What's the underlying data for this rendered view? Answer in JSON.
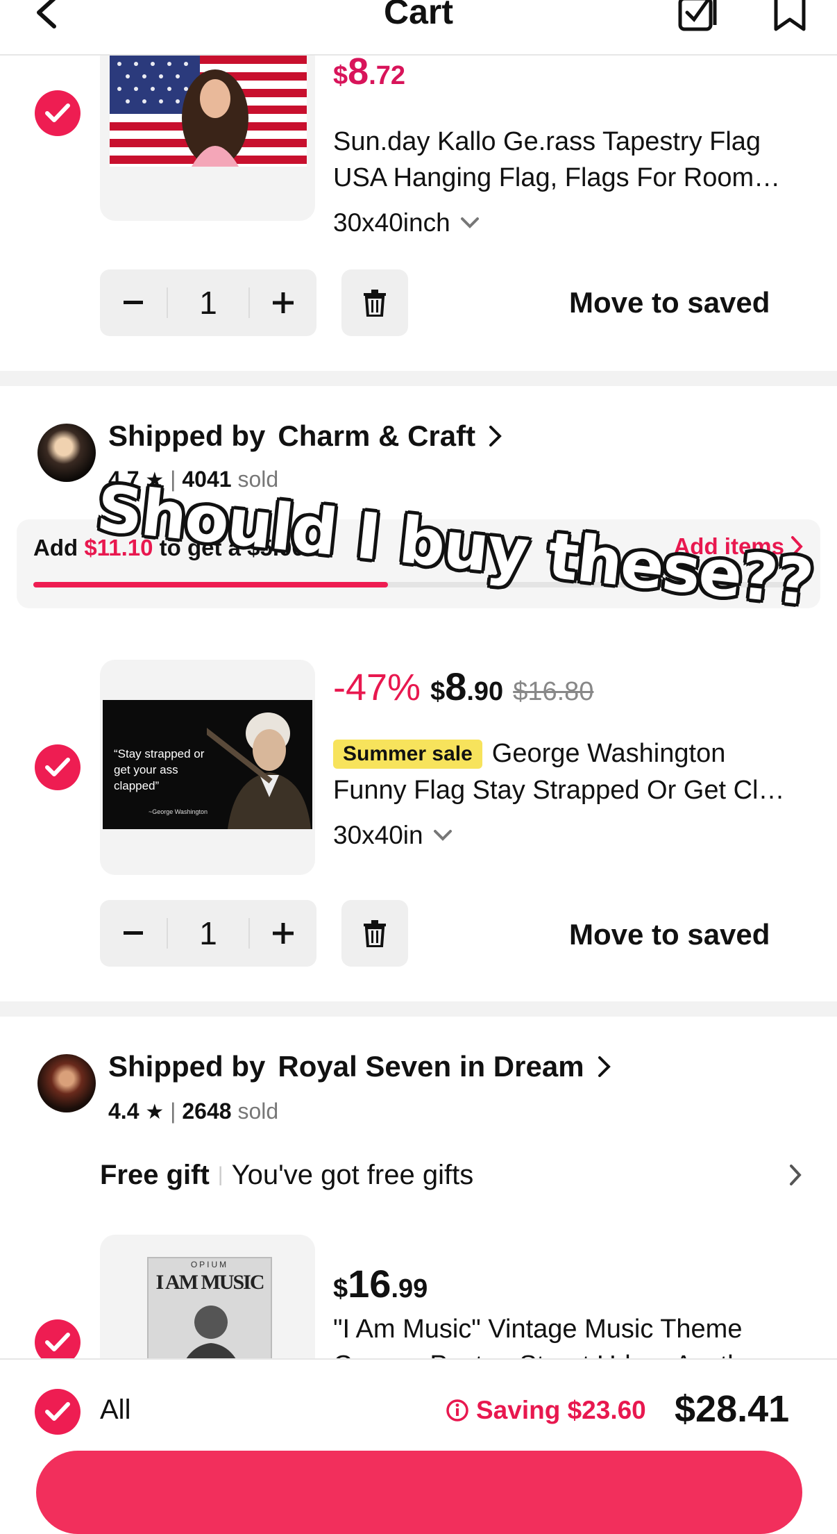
{
  "header": {
    "title": "Cart",
    "back_icon": "chevron-left-icon",
    "select_icon": "multi-select-icon",
    "saved_icon": "bookmark-icon"
  },
  "items": [
    {
      "price_symbol": "$",
      "price_int": "8",
      "price_dec": ".72",
      "title_line1": "Sun.day Kallo Ge.rass Tapestry Flag",
      "title_line2": "USA Hanging Flag, Flags For Room…",
      "variant": "30x40inch",
      "quantity": "1",
      "move_label": "Move to saved",
      "checked": true
    },
    {
      "discount": "-47%",
      "price_symbol": "$",
      "price_int": "8",
      "price_dec": ".90",
      "original_price": "$16.80",
      "badge": "Summer sale",
      "title_line1": "George Washington",
      "title_line2": "Funny Flag Stay Strapped Or Get Cl…",
      "variant": "30x40in",
      "quantity": "1",
      "move_label": "Move to saved",
      "flag_quote": "“Stay strapped or get your ass clapped”",
      "flag_author": "~George Washington",
      "checked": true
    },
    {
      "price_symbol": "$",
      "price_int": "16",
      "price_dec": ".99",
      "title_line1": "\"I Am Music\" Vintage Music Theme",
      "title_line2": "Canvas Poster, Street Urban Aesth…",
      "poster_label_small": "OPIUM",
      "poster_label": "I AM MUSIC",
      "checked": true
    }
  ],
  "shops": [
    {
      "shipped_by": "Shipped by",
      "name": "Charm & Craft",
      "rating": "4.7",
      "sold_count": "4041",
      "sold_label": "sold",
      "promo_prefix": "Add",
      "promo_amount": "$11.10",
      "promo_suffix": "to get a $5.00 c",
      "promo_link": "Add items",
      "promo_progress": 0.46
    },
    {
      "shipped_by": "Shipped by",
      "name": "Royal Seven in Dream",
      "rating": "4.4",
      "sold_count": "2648",
      "sold_label": "sold",
      "gift_title": "Free gift",
      "gift_text": "You've got free gifts"
    }
  ],
  "overlay_caption": "Should I buy these??",
  "footer": {
    "all_label": "All",
    "saving_label": "Saving $23.60",
    "total": "$28.41"
  },
  "colors": {
    "accent": "#ee1d52",
    "price": "#d8145a",
    "badge": "#f7e35c"
  }
}
